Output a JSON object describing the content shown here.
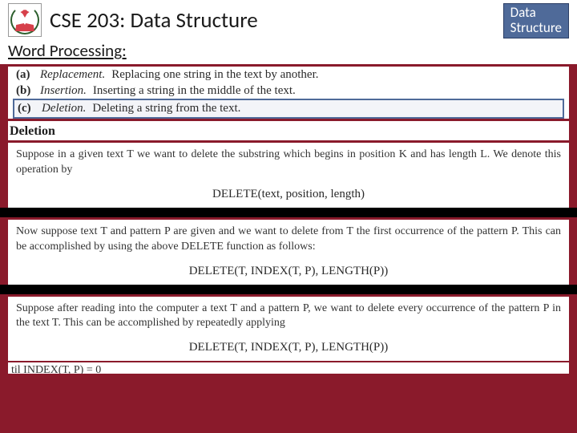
{
  "header": {
    "course_title": "CSE 203: Data Structure",
    "badge_line1": "Data",
    "badge_line2": "Structure"
  },
  "subheader": "Word Processing:",
  "ops": {
    "a": {
      "label": "(a)",
      "name": "Replacement.",
      "desc": "Replacing one string in the text by another."
    },
    "b": {
      "label": "(b)",
      "name": "Insertion.",
      "desc": "Inserting a string in the middle of the text."
    },
    "c": {
      "label": "(c)",
      "name": "Deletion.",
      "desc": "Deleting a string from the text."
    }
  },
  "deletion_heading": "Deletion",
  "para1": "Suppose in a given text T we want to delete the substring which begins in position K and has length L. We denote this operation by",
  "formula1": "DELETE(text, position, length)",
  "para2": "Now suppose text T and pattern P are given and we want to delete from T the first occurrence of the pattern P. This can be accomplished by using the above DELETE function as follows:",
  "formula2": "DELETE(T, INDEX(T, P), LENGTH(P))",
  "para3": "Suppose after reading into the computer a text T and a pattern P, we want to delete every occurrence of the pattern P in the text T. This can be accomplished by repeatedly applying",
  "formula3": "DELETE(T, INDEX(T, P), LENGTH(P))",
  "partial": "til INDEX(T, P) = 0"
}
